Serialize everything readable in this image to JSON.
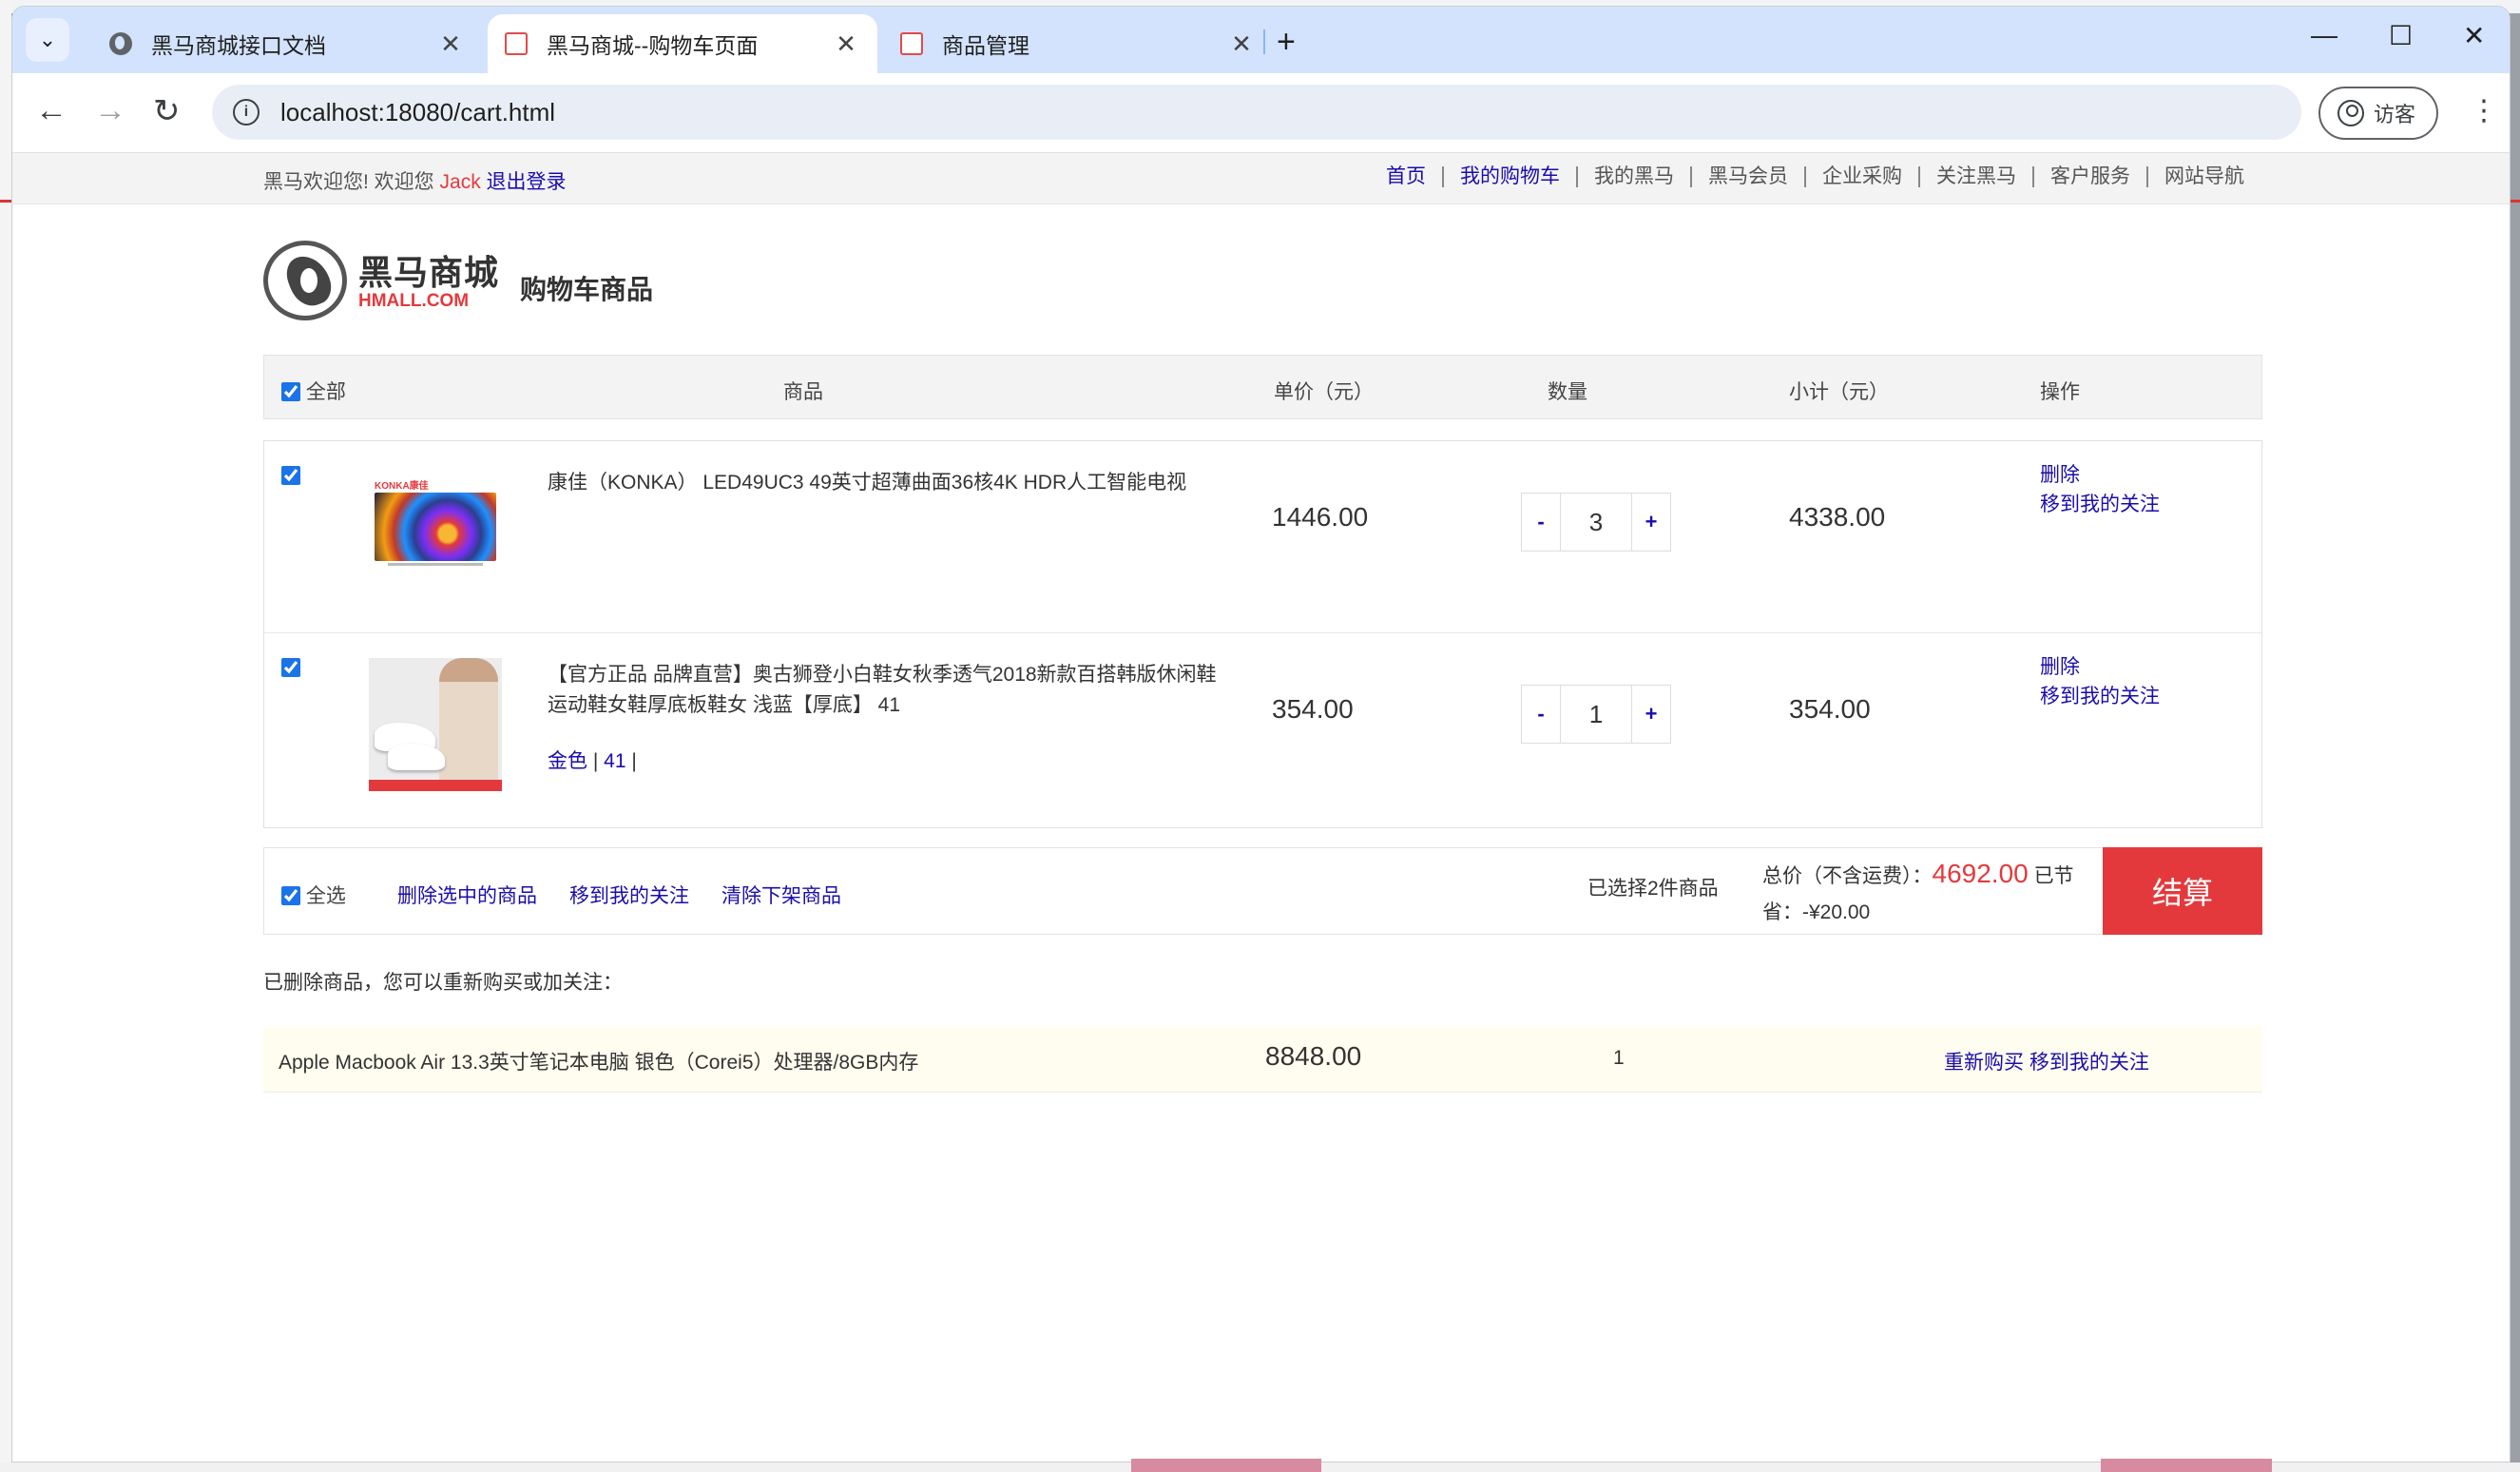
{
  "browser": {
    "tabs": [
      {
        "title": "黑马商城接口文档",
        "icon": "globe-icon",
        "active": false
      },
      {
        "title": "黑马商城--购物车页面",
        "icon": "hmall-favicon",
        "active": true
      },
      {
        "title": "商品管理",
        "icon": "hmall-favicon",
        "active": false
      }
    ],
    "tab_close": "✕",
    "new_tab": "+",
    "url": "localhost:18080/cart.html",
    "profile_label": "访客",
    "minimize": "—",
    "maximize": "☐",
    "close": "✕"
  },
  "shortcut": {
    "welcome": "黑马欢迎您!  欢迎您 ",
    "username": "Jack",
    "logout": " 退出登录",
    "nav": [
      {
        "label": "首页",
        "blue": true
      },
      {
        "label": "我的购物车",
        "blue": true
      },
      {
        "label": "我的黑马",
        "blue": false
      },
      {
        "label": "黑马会员",
        "blue": false
      },
      {
        "label": "企业采购",
        "blue": false
      },
      {
        "label": "关注黑马",
        "blue": false
      },
      {
        "label": "客户服务",
        "blue": false
      },
      {
        "label": "网站导航",
        "blue": false
      }
    ]
  },
  "brand": {
    "name_cn": "黑马商城",
    "name_en": "HMALL.COM",
    "subtitle": "购物车商品"
  },
  "cart_head": {
    "all": "全部",
    "goods": "商品",
    "price": "单价（元）",
    "qty": "数量",
    "subtotal": "小计（元）",
    "ops": "操作"
  },
  "items": [
    {
      "name": "康佳（KONKA） LED49UC3 49英寸超薄曲面36核4K HDR人工智能电视",
      "attrs": "",
      "price": "1446.00",
      "qty": "3",
      "subtotal": "4338.00",
      "delete": "删除",
      "follow": "移到我的关注",
      "image_brand": "KONKA康佳",
      "checked": true
    },
    {
      "name": "【官方正品 品牌直营】奥古狮登小白鞋女秋季透气2018新款百搭韩版休闲鞋运动鞋女鞋厚底板鞋女 浅蓝【厚底】 41",
      "attr_color": "金色",
      "attr_size": "41",
      "sep": "|",
      "price": "354.00",
      "qty": "1",
      "subtotal": "354.00",
      "delete": "删除",
      "follow": "移到我的关注",
      "checked": true
    }
  ],
  "qty_controls": {
    "minus": "-",
    "plus": "+"
  },
  "footer": {
    "select_all": "全选",
    "delete_selected": "删除选中的商品",
    "move_follow": "移到我的关注",
    "clear_offshelf": "清除下架商品",
    "chosen": "已选择2件商品",
    "total_label": "总价（不含运费）：",
    "total_amount": "4692.00",
    "saved_label": "已节省：-¥20.00",
    "checkout": "结算"
  },
  "deleted": {
    "title": "已删除商品，您可以重新购买或加关注：",
    "items": [
      {
        "name": "Apple Macbook Air 13.3英寸笔记本电脑 银色（Corei5）处理器/8GB内存",
        "price": "8848.00",
        "qty": "1",
        "rebuy": "重新购买",
        "follow": "移到我的关注"
      }
    ]
  }
}
